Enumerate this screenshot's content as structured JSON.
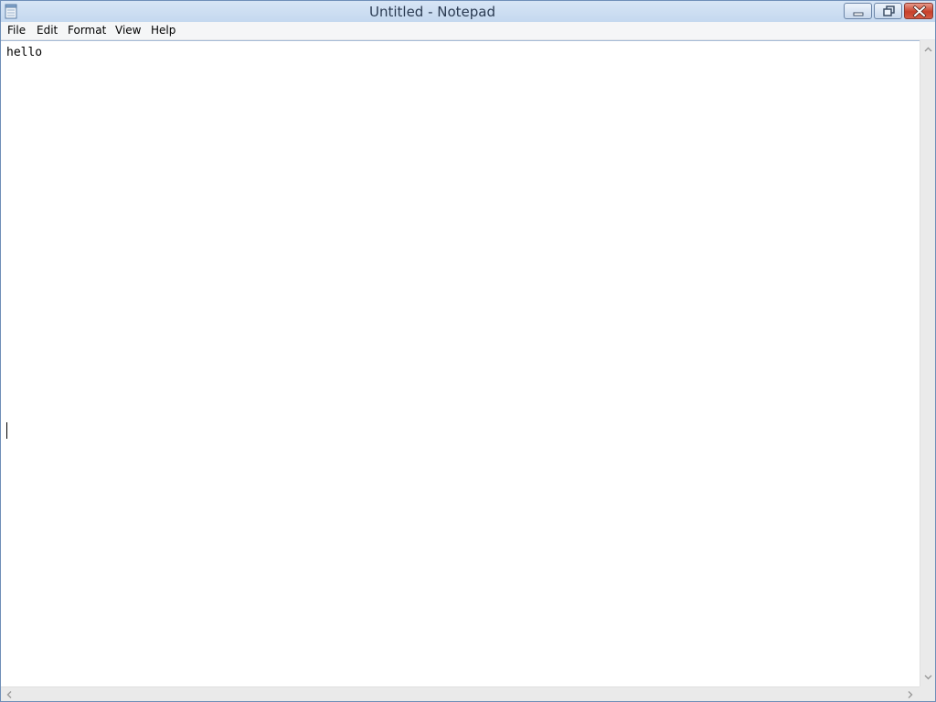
{
  "window": {
    "title": "Untitled - Notepad"
  },
  "menu": {
    "items": [
      "File",
      "Edit",
      "Format",
      "View",
      "Help"
    ]
  },
  "editor": {
    "content": "hello"
  },
  "icons": {
    "app": "notepad-icon",
    "minimize": "minimize-icon",
    "maximize": "restore-icon",
    "close": "close-icon"
  },
  "colors": {
    "titlebar": "#c4d8ef",
    "close_button": "#c7402a",
    "menubar": "#f5f6f7"
  }
}
